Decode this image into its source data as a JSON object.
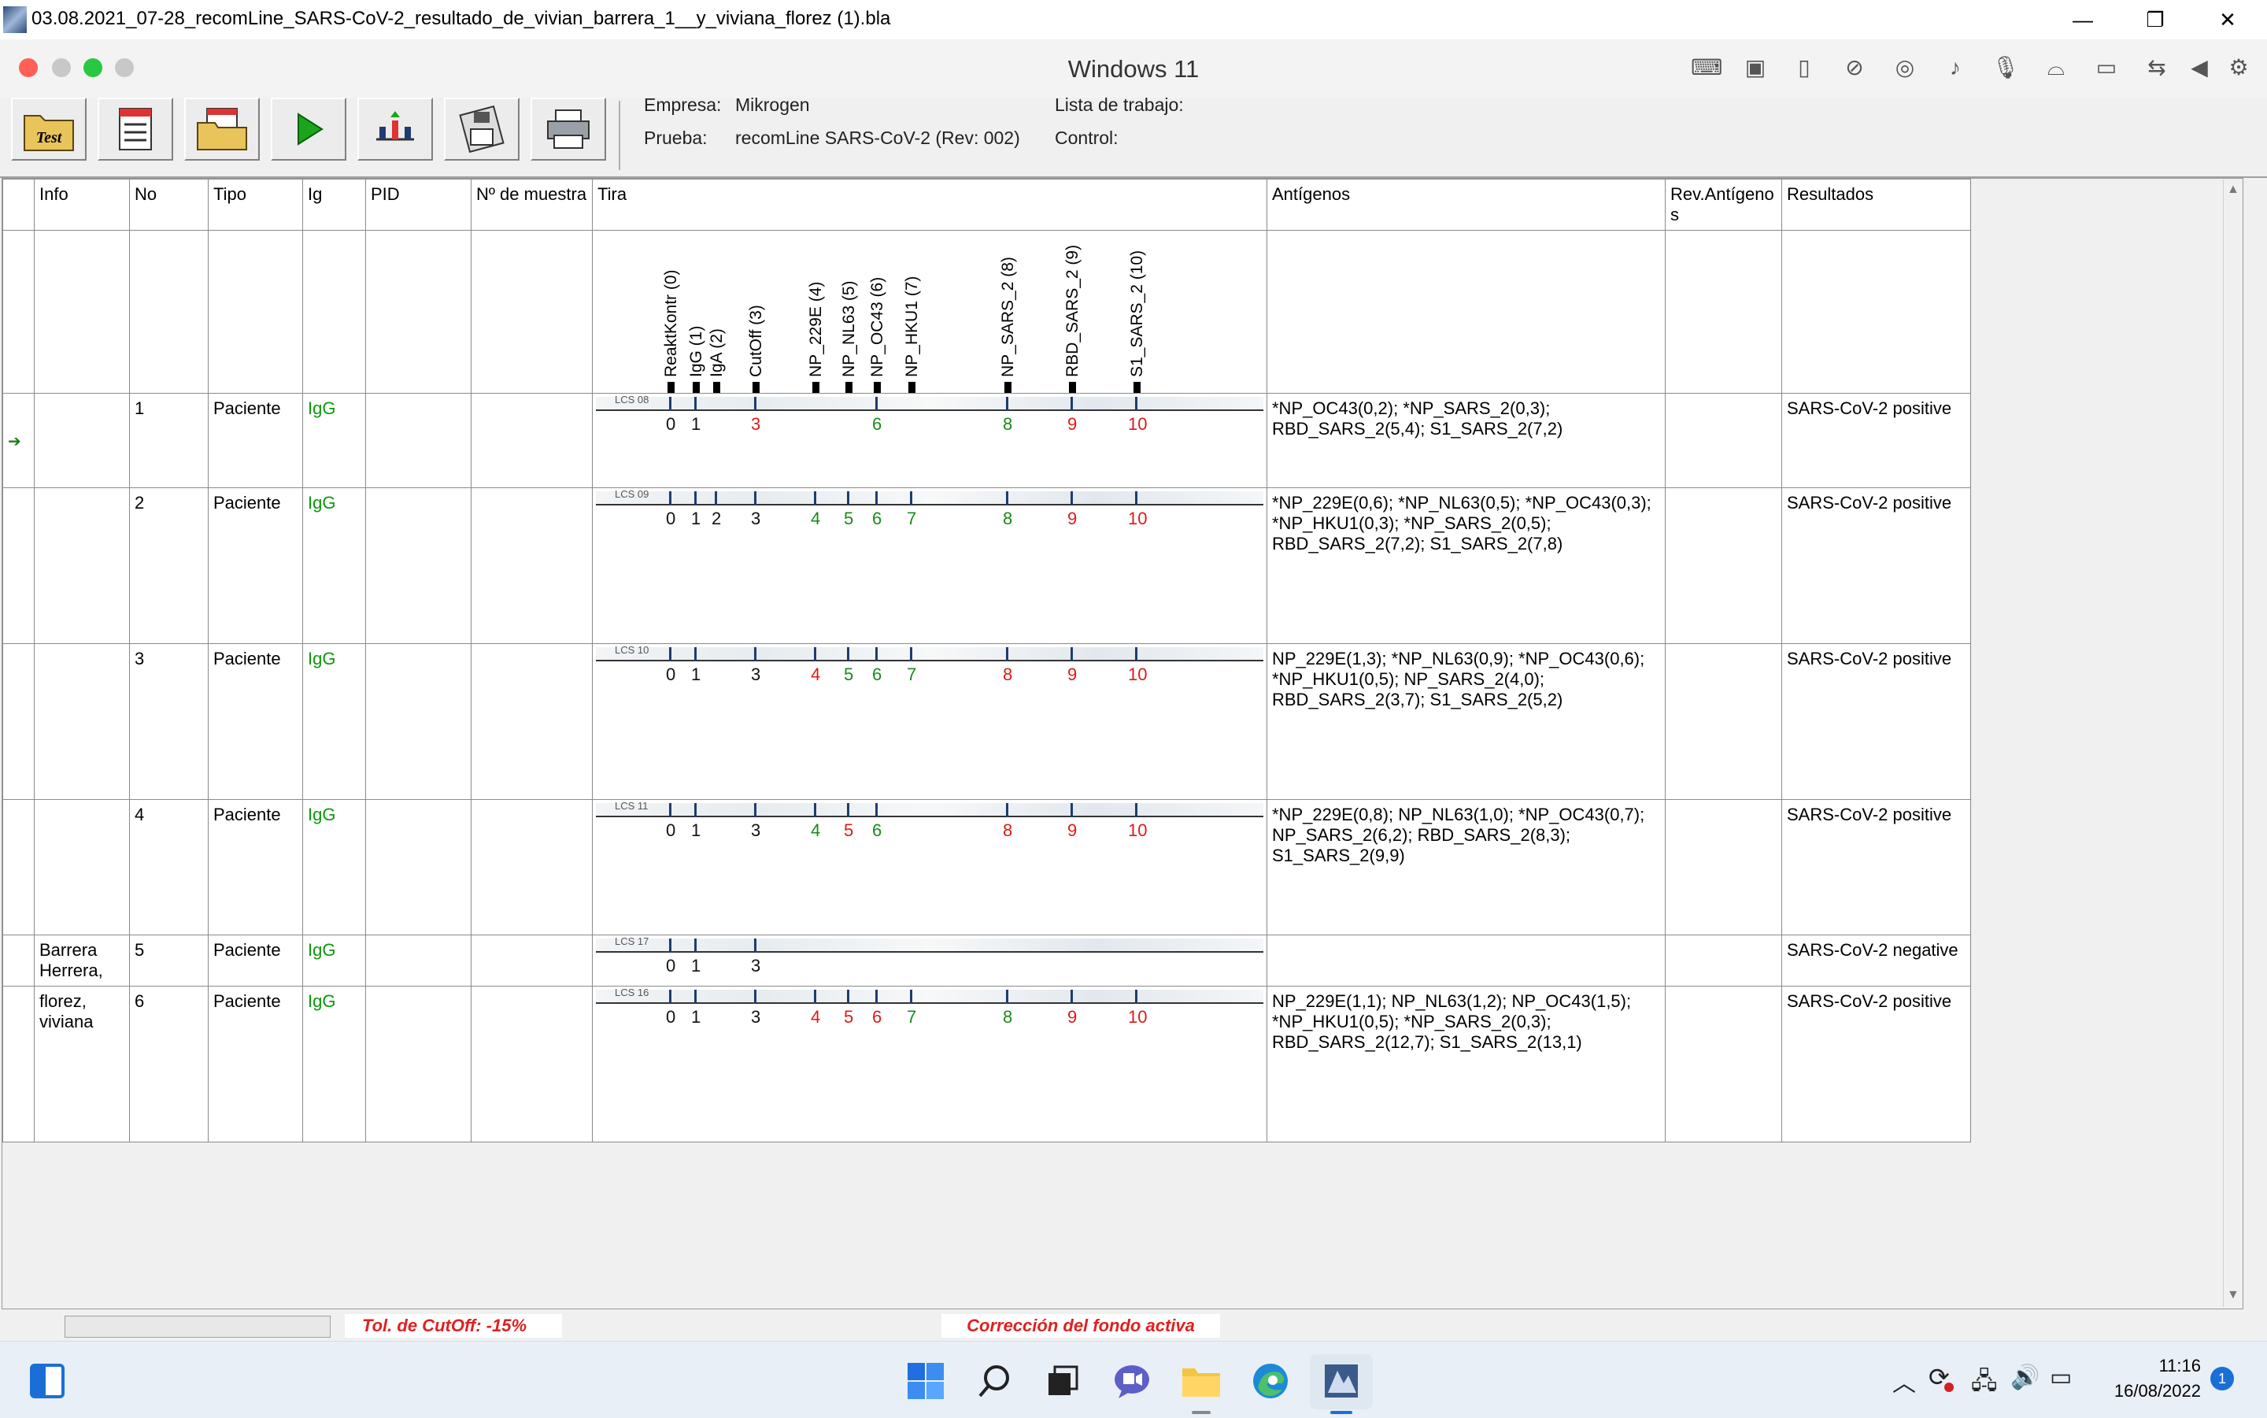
{
  "window": {
    "title": "03.08.2021_07-28_recomLine_SARS-CoV-2_resultado_de_vivian_barrera_1__y_viviana_florez (1).bla",
    "minimize": "—",
    "maximize": "❐",
    "close": "✕"
  },
  "vm": {
    "title": "Windows 11",
    "icons": [
      "⌨",
      "▣",
      "▯",
      "⊘",
      "◎",
      "♪",
      "🎙",
      "⌓",
      "▭",
      "⇆",
      "◀",
      "⚙"
    ]
  },
  "toolbar": {
    "test_label": "Test",
    "empresa_label": "Empresa:",
    "empresa_value": "Mikrogen",
    "lista_label": "Lista de trabajo:",
    "prueba_label": "Prueba:",
    "prueba_value": "recomLine SARS-CoV-2 (Rev: 002)",
    "control_label": "Control:"
  },
  "columns": {
    "info": "Info",
    "no": "No",
    "tipo": "Tipo",
    "ig": "Ig",
    "pid": "PID",
    "muestra": "Nº de muestra",
    "tira": "Tira",
    "antigenos": "Antígenos",
    "rev": "Rev.Antígenos",
    "resultados": "Resultados"
  },
  "strip_header_labels": [
    "ReaktKontr (0)",
    "IgG (1)",
    "IgA (2)",
    "CutOff (3)",
    "NP_229E (4)",
    "NP_NL63 (5)",
    "NP_OC43 (6)",
    "NP_HKU1 (7)",
    "NP_SARS_2 (8)",
    "RBD_SARS_2 (9)",
    "S1_SARS_2 (10)"
  ],
  "rows": [
    {
      "info": "",
      "no": "1",
      "tipo": "Paciente",
      "ig": "IgG",
      "pid": "",
      "muestra": "",
      "strip_id": "LCS 08",
      "antigenos": "*NP_OC43(0,2); *NP_SARS_2(0,3); RBD_SARS_2(5,4); S1_SARS_2(7,2)",
      "rev": "",
      "resultado": "SARS-CoV-2 positive",
      "selected": true,
      "bands": [
        {
          "n": "0",
          "c": "blk"
        },
        {
          "n": "1",
          "c": "blk"
        },
        {
          "n": "3",
          "c": "red"
        },
        {
          "n": "6",
          "c": "grn"
        },
        {
          "n": "8",
          "c": "grn"
        },
        {
          "n": "9",
          "c": "red"
        },
        {
          "n": "10",
          "c": "red"
        }
      ]
    },
    {
      "info": "",
      "no": "2",
      "tipo": "Paciente",
      "ig": "IgG",
      "pid": "",
      "muestra": "",
      "strip_id": "LCS 09",
      "antigenos": "*NP_229E(0,6); *NP_NL63(0,5); *NP_OC43(0,3); *NP_HKU1(0,3); *NP_SARS_2(0,5); RBD_SARS_2(7,2); S1_SARS_2(7,8)",
      "rev": "",
      "resultado": "SARS-CoV-2 positive",
      "selected": false,
      "bands": [
        {
          "n": "0",
          "c": "blk"
        },
        {
          "n": "1",
          "c": "blk"
        },
        {
          "n": "2",
          "c": "blk"
        },
        {
          "n": "3",
          "c": "blk"
        },
        {
          "n": "4",
          "c": "grn"
        },
        {
          "n": "5",
          "c": "grn"
        },
        {
          "n": "6",
          "c": "grn"
        },
        {
          "n": "7",
          "c": "grn"
        },
        {
          "n": "8",
          "c": "grn"
        },
        {
          "n": "9",
          "c": "red"
        },
        {
          "n": "10",
          "c": "red"
        }
      ]
    },
    {
      "info": "",
      "no": "3",
      "tipo": "Paciente",
      "ig": "IgG",
      "pid": "",
      "muestra": "",
      "strip_id": "LCS 10",
      "antigenos": "NP_229E(1,3); *NP_NL63(0,9); *NP_OC43(0,6); *NP_HKU1(0,5); NP_SARS_2(4,0); RBD_SARS_2(3,7); S1_SARS_2(5,2)",
      "rev": "",
      "resultado": "SARS-CoV-2 positive",
      "selected": false,
      "bands": [
        {
          "n": "0",
          "c": "blk"
        },
        {
          "n": "1",
          "c": "blk"
        },
        {
          "n": "3",
          "c": "blk"
        },
        {
          "n": "4",
          "c": "red"
        },
        {
          "n": "5",
          "c": "grn"
        },
        {
          "n": "6",
          "c": "grn"
        },
        {
          "n": "7",
          "c": "grn"
        },
        {
          "n": "8",
          "c": "red"
        },
        {
          "n": "9",
          "c": "red"
        },
        {
          "n": "10",
          "c": "red"
        }
      ]
    },
    {
      "info": "",
      "no": "4",
      "tipo": "Paciente",
      "ig": "IgG",
      "pid": "",
      "muestra": "",
      "strip_id": "LCS 11",
      "antigenos": "*NP_229E(0,8); NP_NL63(1,0); *NP_OC43(0,7); NP_SARS_2(6,2); RBD_SARS_2(8,3); S1_SARS_2(9,9)",
      "rev": "",
      "resultado": "SARS-CoV-2 positive",
      "selected": false,
      "bands": [
        {
          "n": "0",
          "c": "blk"
        },
        {
          "n": "1",
          "c": "blk"
        },
        {
          "n": "3",
          "c": "blk"
        },
        {
          "n": "4",
          "c": "grn"
        },
        {
          "n": "5",
          "c": "red"
        },
        {
          "n": "6",
          "c": "grn"
        },
        {
          "n": "8",
          "c": "red"
        },
        {
          "n": "9",
          "c": "red"
        },
        {
          "n": "10",
          "c": "red"
        }
      ]
    },
    {
      "info": "Barrera Herrera,",
      "no": "5",
      "tipo": "Paciente",
      "ig": "IgG",
      "pid": "",
      "muestra": "",
      "strip_id": "LCS 17",
      "antigenos": "",
      "rev": "",
      "resultado": "SARS-CoV-2 negative",
      "selected": false,
      "bands": [
        {
          "n": "0",
          "c": "blk"
        },
        {
          "n": "1",
          "c": "blk"
        },
        {
          "n": "3",
          "c": "blk"
        }
      ]
    },
    {
      "info": "florez, viviana",
      "no": "6",
      "tipo": "Paciente",
      "ig": "IgG",
      "pid": "",
      "muestra": "",
      "strip_id": "LCS 16",
      "antigenos": "NP_229E(1,1); NP_NL63(1,2); NP_OC43(1,5); *NP_HKU1(0,5); *NP_SARS_2(0,3); RBD_SARS_2(12,7); S1_SARS_2(13,1)",
      "rev": "",
      "resultado": "SARS-CoV-2 positive",
      "selected": false,
      "bands": [
        {
          "n": "0",
          "c": "blk"
        },
        {
          "n": "1",
          "c": "blk"
        },
        {
          "n": "3",
          "c": "blk"
        },
        {
          "n": "4",
          "c": "red"
        },
        {
          "n": "5",
          "c": "red"
        },
        {
          "n": "6",
          "c": "red"
        },
        {
          "n": "7",
          "c": "grn"
        },
        {
          "n": "8",
          "c": "grn"
        },
        {
          "n": "9",
          "c": "red"
        },
        {
          "n": "10",
          "c": "red"
        }
      ]
    }
  ],
  "status": {
    "cutoff": "Tol. de CutOff: -15%",
    "fondo": "Corrección del fondo activa"
  },
  "taskbar": {
    "time": "11:16",
    "date": "16/08/2022",
    "notifications": "1"
  },
  "colors": {
    "positive_band": "#1a8a1a",
    "negative_band": "#e01818",
    "status_text": "#e02020",
    "ig_text": "#0a9a0a"
  }
}
